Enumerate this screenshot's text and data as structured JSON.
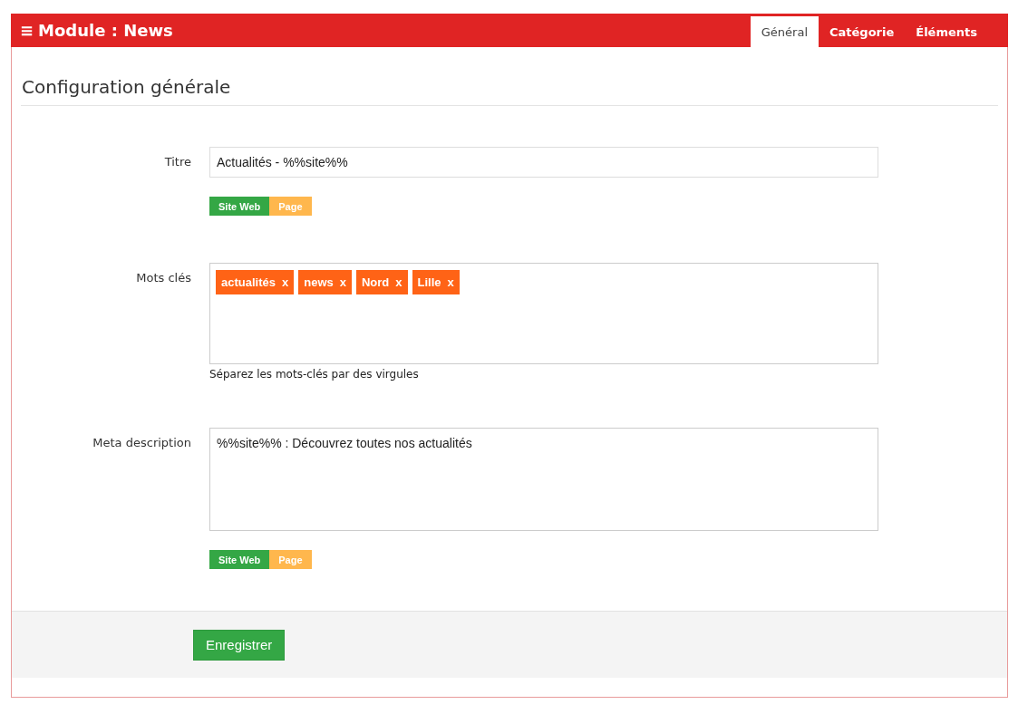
{
  "header": {
    "menu_glyph": "≡",
    "title": "Module : News"
  },
  "tabs": [
    {
      "label": "Général",
      "selected": true
    },
    {
      "label": "Catégorie",
      "selected": false
    },
    {
      "label": "Éléments",
      "selected": false
    }
  ],
  "section_title": "Configuration générale",
  "fields": [
    {
      "kind": "input",
      "label": "Titre",
      "value": "Actualités - %%site%%",
      "variables": [
        {
          "label": "Site Web",
          "kind": "site"
        },
        {
          "label": "Page",
          "kind": "page"
        }
      ]
    },
    {
      "kind": "tags",
      "label": "Mots clés",
      "tags": [
        {
          "label": "actualités",
          "remove": "x"
        },
        {
          "label": "news",
          "remove": "x"
        },
        {
          "label": "Nord",
          "remove": "x"
        },
        {
          "label": "Lille",
          "remove": "x"
        }
      ],
      "help": "Séparez les mots-clés par des virgules"
    },
    {
      "kind": "textarea",
      "label": "Meta description",
      "value": "%%site%% : Découvrez toutes nos actualités",
      "variables": [
        {
          "label": "Site Web",
          "kind": "site"
        },
        {
          "label": "Page",
          "kind": "page"
        }
      ]
    }
  ],
  "save_button": "Enregistrer"
}
